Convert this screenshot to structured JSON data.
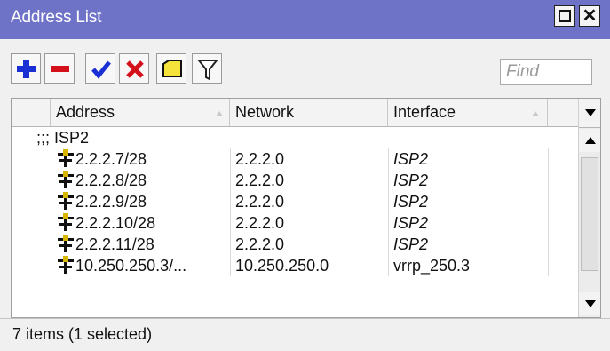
{
  "window": {
    "title": "Address List",
    "title_bar_color": "#6f73c8"
  },
  "toolbar": {
    "buttons": [
      {
        "name": "add",
        "icon": "plus-icon",
        "color": "#1a2fd4"
      },
      {
        "name": "remove",
        "icon": "minus-icon",
        "color": "#d4101a"
      },
      {
        "name": "enable",
        "icon": "checkmark-icon",
        "color": "#1a2fd4"
      },
      {
        "name": "disable",
        "icon": "x-icon",
        "color": "#d4101a"
      },
      {
        "name": "comment",
        "icon": "note-icon",
        "color": "#f5e23a"
      },
      {
        "name": "filter",
        "icon": "filter-icon",
        "color": "#222222"
      }
    ],
    "find_placeholder": "Find"
  },
  "table": {
    "columns": [
      "Address",
      "Network",
      "Interface"
    ],
    "comment": ";;; ISP2",
    "rows": [
      {
        "address": "2.2.2.7/28",
        "network": "2.2.2.0",
        "interface": "ISP2",
        "dynamic": true
      },
      {
        "address": "2.2.2.8/28",
        "network": "2.2.2.0",
        "interface": "ISP2",
        "dynamic": true
      },
      {
        "address": "2.2.2.9/28",
        "network": "2.2.2.0",
        "interface": "ISP2",
        "dynamic": true
      },
      {
        "address": "2.2.2.10/28",
        "network": "2.2.2.0",
        "interface": "ISP2",
        "dynamic": true
      },
      {
        "address": "2.2.2.11/28",
        "network": "2.2.2.0",
        "interface": "ISP2",
        "dynamic": true
      },
      {
        "address": "10.250.250.3/...",
        "network": "10.250.250.0",
        "interface": "vrrp_250.3",
        "dynamic": false
      }
    ]
  },
  "status": {
    "text": "7 items (1 selected)"
  }
}
